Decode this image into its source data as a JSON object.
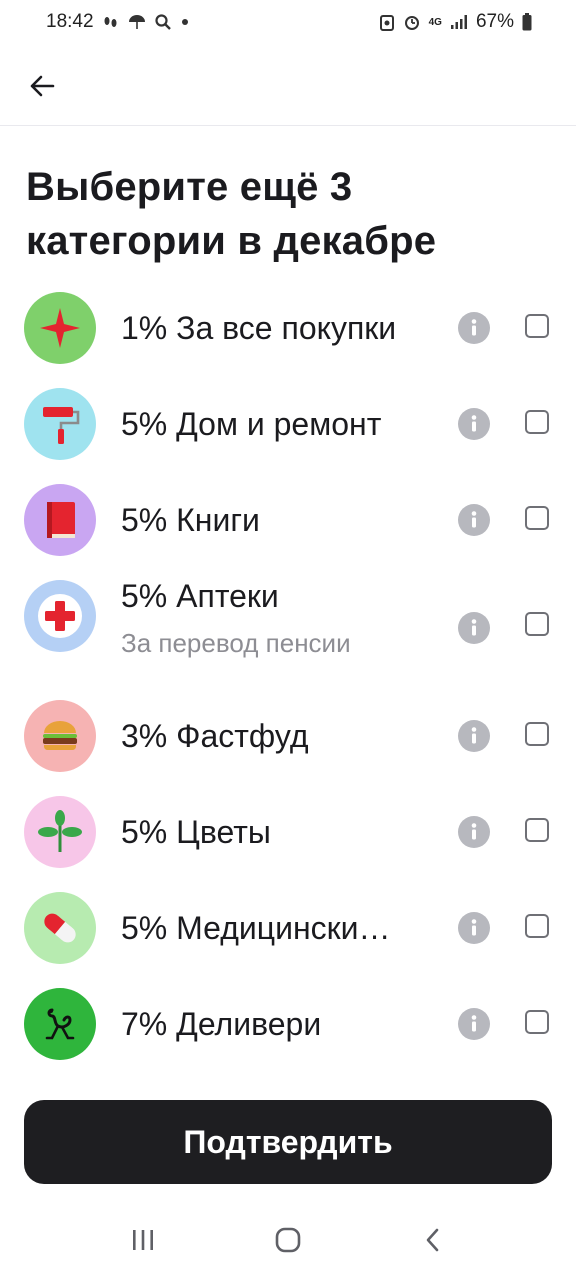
{
  "status_bar": {
    "time": "18:42",
    "battery": "67%",
    "network": "4G"
  },
  "header": {
    "back_icon": "arrow-left-icon"
  },
  "title": "Выберите ещё 3 категории в декабре",
  "categories": [
    {
      "label": "1% За все покупки",
      "sublabel": "",
      "icon": "red-star-icon",
      "bg": "#7fd06b",
      "checked": false
    },
    {
      "label": "5% Дом и ремонт",
      "sublabel": "",
      "icon": "paint-roller-icon",
      "bg": "#9fe3ef",
      "checked": false
    },
    {
      "label": "5% Книги",
      "sublabel": "",
      "icon": "book-icon",
      "bg": "#c9a6f2",
      "checked": false
    },
    {
      "label": "5% Аптеки",
      "sublabel": "За перевод пенсии",
      "icon": "pharmacy-cross-icon",
      "bg": "#b5d0f5",
      "checked": false
    },
    {
      "label": "3% Фастфуд",
      "sublabel": "",
      "icon": "burger-icon",
      "bg": "#f6b3b3",
      "checked": false
    },
    {
      "label": "5% Цветы",
      "sublabel": "",
      "icon": "sprout-icon",
      "bg": "#f7c6e8",
      "checked": false
    },
    {
      "label": "5% Медицински…",
      "sublabel": "",
      "icon": "pill-icon",
      "bg": "#b7ebb0",
      "checked": false
    },
    {
      "label": "7% Деливери",
      "sublabel": "",
      "icon": "ostrich-icon",
      "bg": "#2fb53c",
      "checked": false
    }
  ],
  "confirm_label": "Подтвердить",
  "colors": {
    "accent_dark": "#1e1e21",
    "info_gray": "#b7b8be"
  }
}
